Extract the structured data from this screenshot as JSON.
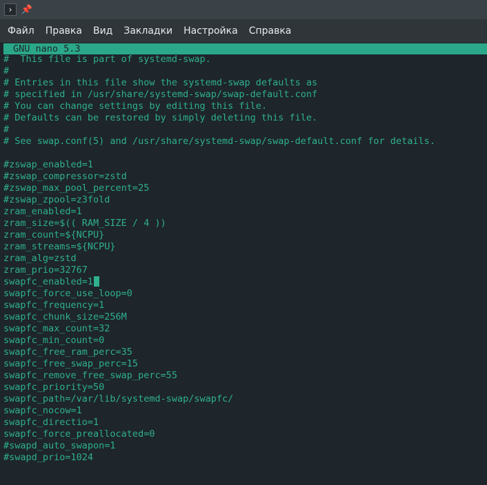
{
  "titlebar": {
    "app_icon": "terminal-icon",
    "app_icon_glyph": "›",
    "pin_icon": "pin-icon",
    "pin_glyph": "📌"
  },
  "menu": [
    "Файл",
    "Правка",
    "Вид",
    "Закладки",
    "Настройка",
    "Справка"
  ],
  "editor": {
    "header": "GNU nano 5.3",
    "cursor_line": 20,
    "lines": [
      "#  This file is part of systemd-swap.",
      "#",
      "# Entries in this file show the systemd-swap defaults as",
      "# specified in /usr/share/systemd-swap/swap-default.conf",
      "# You can change settings by editing this file.",
      "# Defaults can be restored by simply deleting this file.",
      "#",
      "# See swap.conf(5) and /usr/share/systemd-swap/swap-default.conf for details.",
      "",
      "#zswap_enabled=1",
      "#zswap_compressor=zstd",
      "#zswap_max_pool_percent=25",
      "#zswap_zpool=z3fold",
      "zram_enabled=1",
      "zram_size=$(( RAM_SIZE / 4 ))",
      "zram_count=${NCPU}",
      "zram_streams=${NCPU}",
      "zram_alg=zstd",
      "zram_prio=32767",
      "swapfc_enabled=1",
      "swapfc_force_use_loop=0",
      "swapfc_frequency=1",
      "swapfc_chunk_size=256M",
      "swapfc_max_count=32",
      "swapfc_min_count=0",
      "swapfc_free_ram_perc=35",
      "swapfc_free_swap_perc=15",
      "swapfc_remove_free_swap_perc=55",
      "swapfc_priority=50",
      "swapfc_path=/var/lib/systemd-swap/swapfc/",
      "swapfc_nocow=1",
      "swapfc_directio=1",
      "swapfc_force_preallocated=0",
      "#swapd_auto_swapon=1",
      "#swapd_prio=1024"
    ]
  }
}
